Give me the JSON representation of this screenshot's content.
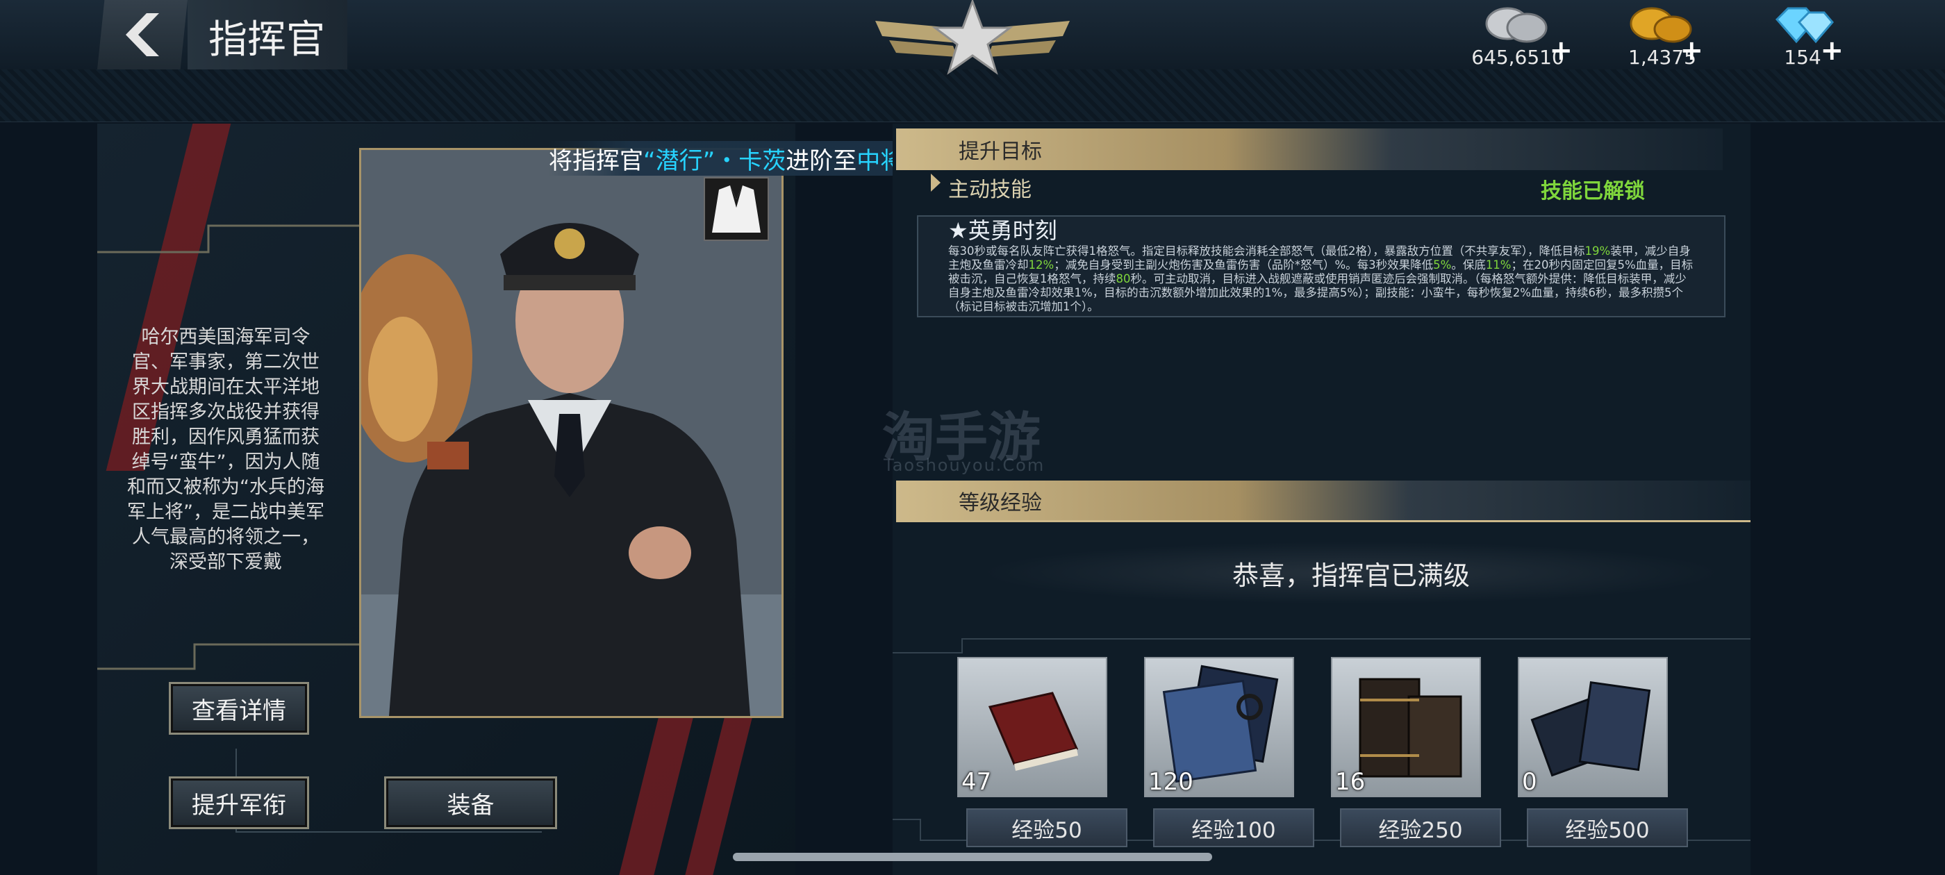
{
  "header": {
    "title": "指挥官",
    "resources": [
      {
        "icon": "silver-coin-icon",
        "value": "645,6510",
        "plus": "+"
      },
      {
        "icon": "gold-coin-icon",
        "value": "1,4375",
        "plus": "+"
      },
      {
        "icon": "diamond-icon",
        "value": "154",
        "plus": "+"
      }
    ]
  },
  "banner": {
    "prefix": "将指挥官",
    "name": "“潜行”・卡茨",
    "middle": "进阶至",
    "rank": "中将"
  },
  "commander": {
    "bio": "哈尔西美国海军司令官、军事家，第二次世界大战期间在太平洋地区指挥多次战役并获得胜利，因作风勇猛而获绰号“蛮牛”，因为人随和而又被称为“水兵的海军上将”，是二战中美军人气最高的将领之一，深受部下爱戴"
  },
  "buttons": {
    "details": "查看详情",
    "promote": "提升军衔",
    "equip": "装备"
  },
  "upgrade_target": {
    "header": "提升目标",
    "section": "主动技能",
    "status": "技能已解锁",
    "skill_name": "★英勇时刻",
    "desc": [
      {
        "t": "每30秒或每名队友阵亡获得1格怒气。指定目标释放技能会消耗全部怒气（最低2格），暴露敌方位置（不共享友军），降低目标"
      },
      {
        "t": "19%",
        "h": true
      },
      {
        "t": "装甲，减少自身主炮及鱼雷冷却"
      },
      {
        "t": "12%",
        "h": true
      },
      {
        "t": "；减免自身受到主副火炮伤害及鱼雷伤害（品阶*怒气）%。每3秒效果降低"
      },
      {
        "t": "5%",
        "h": true
      },
      {
        "t": "。保底"
      },
      {
        "t": "11%",
        "h": true
      },
      {
        "t": "；在20秒内固定回复5%血量，目标被击沉，自己恢复1格怒气，持续"
      },
      {
        "t": "80",
        "h": true
      },
      {
        "t": "秒。可主动取消，目标进入战舰遮蔽或使用销声匿迹后会强制取消。（每格怒气额外提供：降低目标装甲，减少自身主炮及鱼雷冷却效果1%，目标的击沉数额外增加此效果的1%，最多提高5%）；副技能：小蛮牛，每秒恢复2%血量，持续6秒，最多积攒5个（标记目标被击沉增加1个）。"
      }
    ]
  },
  "level_exp": {
    "header": "等级经验",
    "max_message": "恭喜，指挥官已满级",
    "items": [
      {
        "icon": "red-book-icon",
        "count": "47",
        "exp_label": "经验50"
      },
      {
        "icon": "blue-manual-icon",
        "count": "120",
        "exp_label": "经验100"
      },
      {
        "icon": "leather-books-icon",
        "count": "16",
        "exp_label": "经验250"
      },
      {
        "icon": "navy-books-icon",
        "count": "0",
        "exp_label": "经验500"
      }
    ]
  },
  "watermark": {
    "main": "淘手游",
    "sub": "Taoshouyou.Com"
  },
  "colors": {
    "accent_gold": "#cdb98a",
    "skill_unlocked": "#7fd63c",
    "highlight_cyan": "#27d3ff"
  }
}
